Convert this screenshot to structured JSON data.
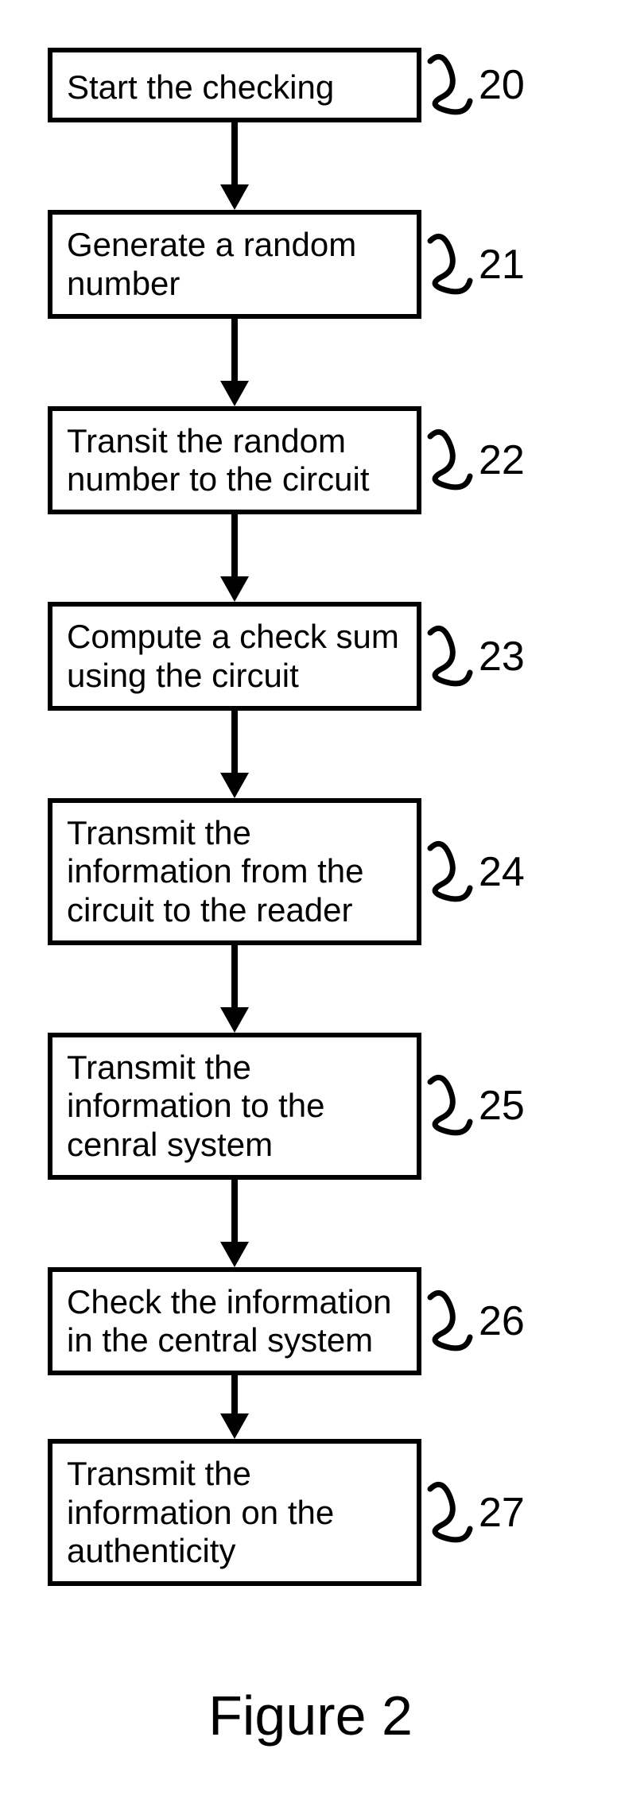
{
  "steps": [
    {
      "label": "20",
      "text": "Start the checking"
    },
    {
      "label": "21",
      "text": "Generate a random number"
    },
    {
      "label": "22",
      "text": "Transit the random number to the circuit"
    },
    {
      "label": "23",
      "text": "Compute a check sum using the circuit"
    },
    {
      "label": "24",
      "text": "Transmit the information from the circuit to the reader"
    },
    {
      "label": "25",
      "text": "Transmit the information to the cenral system"
    },
    {
      "label": "26",
      "text": "Check the information in the central system"
    },
    {
      "label": "27",
      "text": "Transmit the information on the authenticity"
    }
  ],
  "caption": "Figure 2"
}
